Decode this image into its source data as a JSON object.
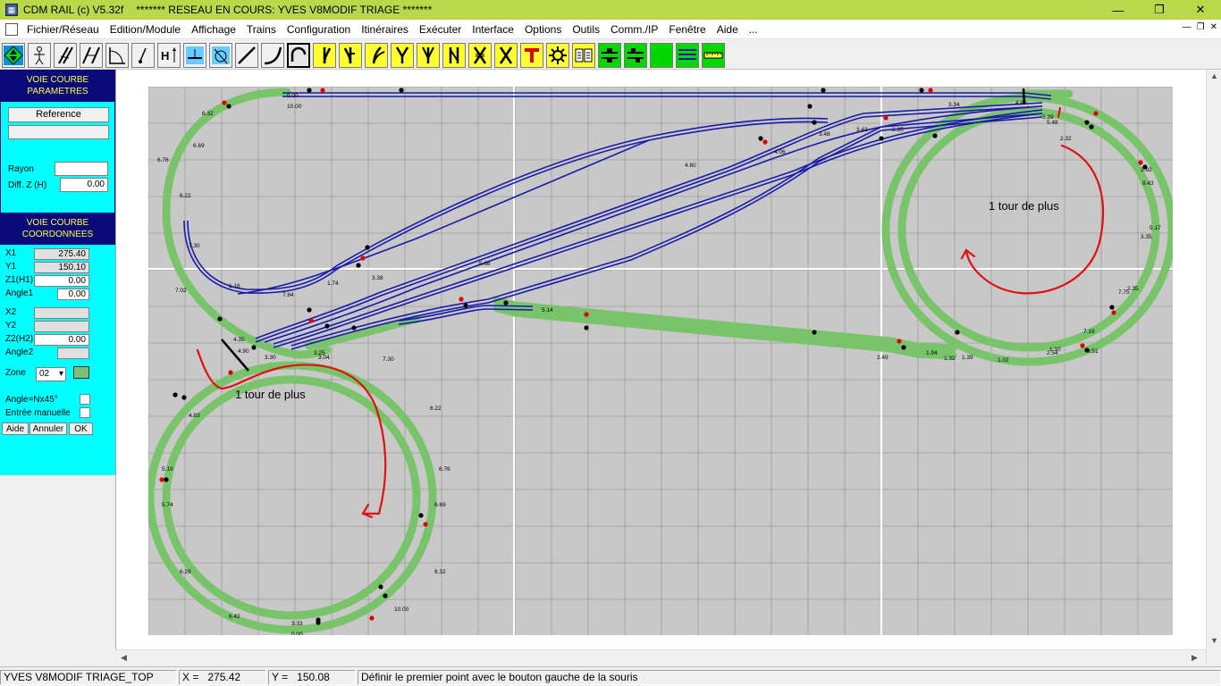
{
  "window": {
    "app_title": "CDM RAIL (c) V5.32f",
    "doc_title": "******* RESEAU EN COURS: YVES V8MODIF TRIAGE *******",
    "minimize": "—",
    "maximize": "❐",
    "close": "✕"
  },
  "menu": [
    "Fichier/Réseau",
    "Edition/Module",
    "Affichage",
    "Trains",
    "Configuration",
    "Itinéraires",
    "Exécuter",
    "Interface",
    "Options",
    "Outils",
    "Comm./IP",
    "Fenêtre",
    "Aide",
    "..."
  ],
  "toolbar": {
    "tools": [
      {
        "name": "select-tool",
        "icon": "diamond-arrows-icon"
      },
      {
        "name": "person-tool",
        "icon": "person-icon"
      },
      {
        "name": "rail-diag-tool",
        "icon": "rail-diag-icon"
      },
      {
        "name": "double-rail-tool",
        "icon": "double-rail-icon"
      },
      {
        "name": "angle-tool",
        "icon": "angle-icon"
      },
      {
        "name": "point-tool",
        "icon": "point-icon"
      },
      {
        "name": "height-tool",
        "icon": "height-icon"
      },
      {
        "name": "level-tool",
        "icon": "level-icon"
      },
      {
        "name": "turntable-tool",
        "icon": "turntable-icon"
      },
      {
        "name": "straight-track-tool",
        "icon": "straight-line-icon"
      },
      {
        "name": "curve-track-tool",
        "icon": "curve-line-icon"
      },
      {
        "name": "curved-track-tool",
        "icon": "curve-selected-icon"
      },
      {
        "name": "switch-left-tool",
        "icon": "switch-left-icon"
      },
      {
        "name": "switch-right-tool",
        "icon": "switch-right-icon"
      },
      {
        "name": "curved-switch-tool",
        "icon": "curved-switch-icon"
      },
      {
        "name": "wye-switch-tool",
        "icon": "wye-switch-icon"
      },
      {
        "name": "three-way-switch-tool",
        "icon": "three-way-switch-icon"
      },
      {
        "name": "double-slip-tool",
        "icon": "double-slip-icon"
      },
      {
        "name": "crossing-tool",
        "icon": "crossing-icon"
      },
      {
        "name": "cross-tool",
        "icon": "cross-icon"
      },
      {
        "name": "tee-tool",
        "icon": "tee-icon"
      },
      {
        "name": "gear-tool",
        "icon": "gear-icon"
      },
      {
        "name": "book-tool",
        "icon": "book-icon"
      },
      {
        "name": "signal-tool",
        "icon": "signal-icon"
      },
      {
        "name": "signal2-tool",
        "icon": "signal-block-icon"
      },
      {
        "name": "green-tool",
        "icon": "green-block-icon"
      },
      {
        "name": "lines-tool",
        "icon": "lines-icon"
      },
      {
        "name": "ruler-tool",
        "icon": "ruler-icon"
      }
    ]
  },
  "panel": {
    "section1_title_a": "VOIE COURBE",
    "section1_title_b": "PARAMETRES",
    "reference_label": "Reference",
    "reference_value": "",
    "rayon_label": "Rayon",
    "rayon_value": "",
    "diffz_label": "Diff. Z (H)",
    "diffz_value": "0.00",
    "section2_title_a": "VOIE COURBE",
    "section2_title_b": "COORDONNEES",
    "x1_label": "X1",
    "x1_value": "275.40",
    "y1_label": "Y1",
    "y1_value": "150.10",
    "z1_label": "Z1(H1)",
    "z1_value": "0.00",
    "angle1_label": "Angle1",
    "angle1_value": "0.00",
    "x2_label": "X2",
    "x2_value": "",
    "y2_label": "Y2",
    "y2_value": "",
    "z2_label": "Z2(H2)",
    "z2_value": "0.00",
    "angle2_label": "Angle2",
    "angle2_value": "",
    "zone_label": "Zone",
    "zone_value": "02",
    "anglenx_label": "Angle=Nx45°",
    "manual_label": "Entrée manuelle",
    "aide": "Aide",
    "annuler": "Annuler",
    "ok": "OK"
  },
  "drawing": {
    "annotation_left": "1 tour de plus",
    "annotation_right": "1 tour de plus",
    "colors": {
      "track_green": "#79c46a",
      "track_blue": "#1a1aa8",
      "annotation_red": "#e01010",
      "canvas": "#c8c8c8"
    },
    "labels": [
      "0.00",
      "10.00",
      "6.32",
      "6.69",
      "6.76",
      "6.22",
      "7.30",
      "7.02",
      "1.16",
      "7.84",
      "1.74",
      "3.38",
      "5.68",
      "5.14",
      "4.60",
      "4.06",
      "3.48",
      "3.43",
      "2.35",
      "3.34",
      "4.90",
      "5.39",
      "5.48",
      "2.32",
      "3.92",
      "8.43",
      "5.17",
      "3.35",
      "7.75",
      "7.19",
      "0.51",
      "1.10",
      "1.02",
      "1.39",
      "1.32",
      "1.94",
      "2.49",
      "2.35",
      "2.54",
      "3.04",
      "3.25",
      "3.30",
      "4.35",
      "4.90",
      "4.83",
      "5.19",
      "5.74",
      "6.29",
      "6.42",
      "3.33"
    ]
  },
  "status": {
    "network": "YVES V8MODIF TRIAGE_TOP",
    "x_label": "X =",
    "x_value": "275.42",
    "y_label": "Y =",
    "y_value": "150.08",
    "message": "Définir le premier point avec le bouton gauche de la souris"
  }
}
